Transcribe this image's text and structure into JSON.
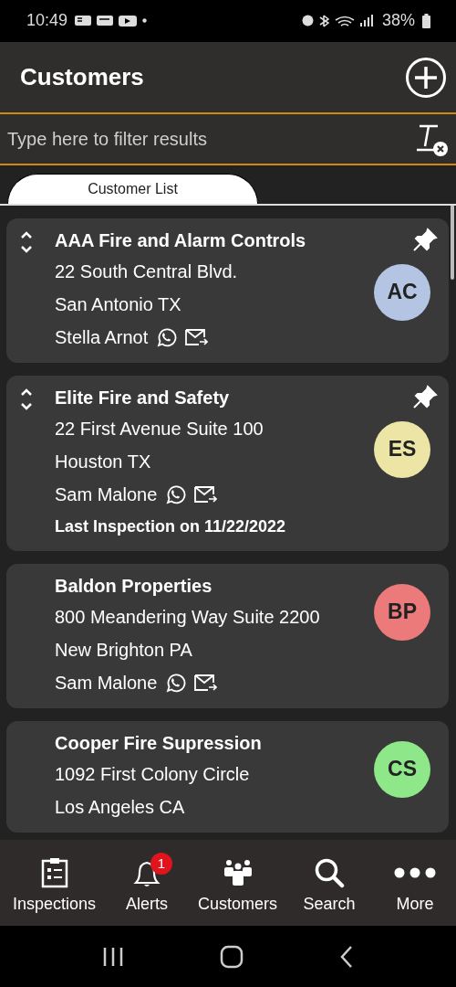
{
  "status_bar": {
    "time": "10:49",
    "battery": "38%"
  },
  "header": {
    "title": "Customers"
  },
  "filter": {
    "placeholder": "Type here to filter results"
  },
  "tabs": [
    {
      "label": "Customer List",
      "selected": true
    }
  ],
  "customers": [
    {
      "name": "AAA Fire and Alarm Controls",
      "address": "22 South Central Blvd.",
      "city": "San Antonio TX",
      "contact": "Stella Arnot",
      "initials": "AC",
      "color": "#b3c5e3",
      "pinned": true
    },
    {
      "name": "Elite Fire and Safety",
      "address": "22 First Avenue Suite 100",
      "city": "Houston TX",
      "contact": "Sam Malone",
      "last_inspection": "Last Inspection on 11/22/2022",
      "initials": "ES",
      "color": "#ede5a6",
      "pinned": true
    },
    {
      "name": "Baldon Properties",
      "address": "800 Meandering Way Suite 2200",
      "city": "New Brighton PA",
      "contact": "Sam Malone",
      "initials": "BP",
      "color": "#ec7a7a",
      "pinned": false
    },
    {
      "name": "Cooper Fire Supression",
      "address": "1092 First Colony Circle",
      "city": "Los Angeles CA",
      "initials": "CS",
      "color": "#8ee88a",
      "pinned": false
    }
  ],
  "nav": [
    {
      "kind": "clipboard",
      "label": "Inspections"
    },
    {
      "kind": "bell",
      "label": "Alerts",
      "badge": "1"
    },
    {
      "kind": "people",
      "label": "Customers"
    },
    {
      "kind": "search",
      "label": "Search"
    },
    {
      "kind": "dots",
      "label": "More"
    }
  ]
}
